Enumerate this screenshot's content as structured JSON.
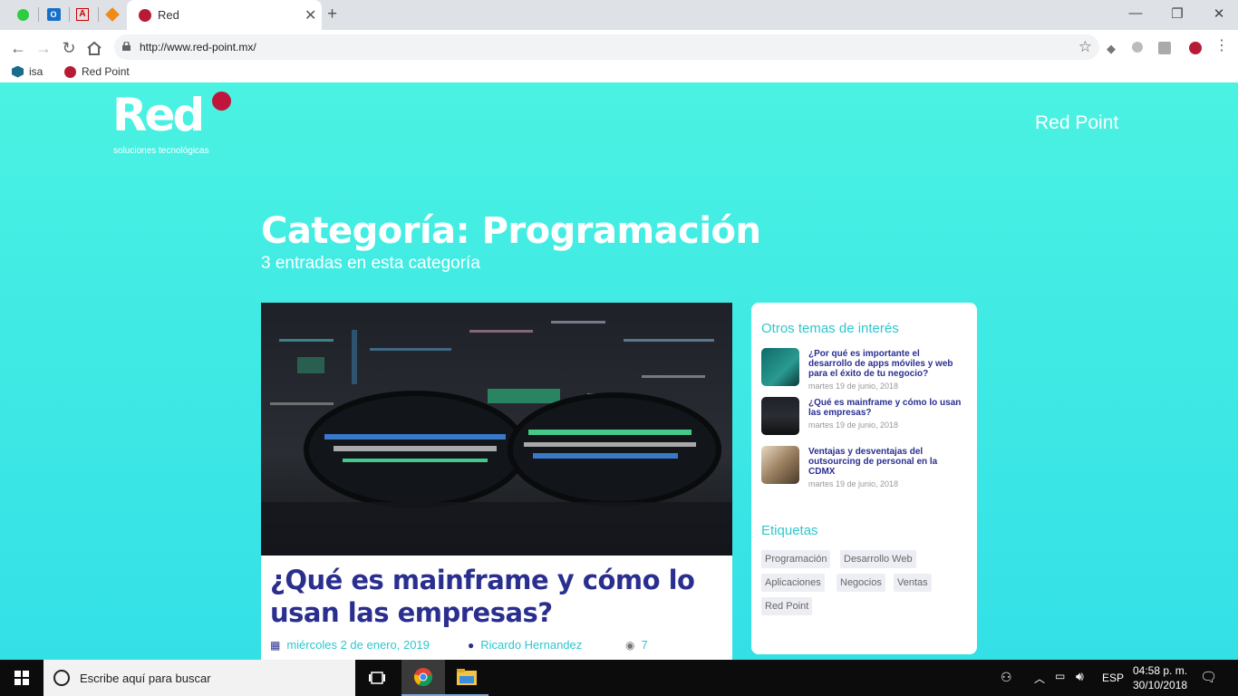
{
  "browser": {
    "tab_title": "Red",
    "url": "http://www.red-point.mx/",
    "bookmarks": [
      {
        "label": "isa"
      },
      {
        "label": "Red Point"
      }
    ]
  },
  "site": {
    "logo_text": "Red",
    "logo_tagline": "soluciones tecnológicas",
    "nav_title": "Red Point",
    "category_title": "Categoría: Programación",
    "category_subtitle": "3 entradas en esta categoría"
  },
  "post": {
    "title": "¿Qué es mainframe y cómo lo usan las empresas?",
    "date": "miércoles 2 de enero, 2019",
    "author": "Ricardo Hernandez",
    "views": "7"
  },
  "sidebar": {
    "heading": "Otros temas de interés",
    "items": [
      {
        "title": "¿Por qué es importante el desarrollo de apps móviles y web para el éxito de tu negocio?",
        "date": "martes 19 de junio, 2018"
      },
      {
        "title": "¿Qué es mainframe y cómo lo usan las empresas?",
        "date": "martes 19 de junio, 2018"
      },
      {
        "title": "Ventajas y desventajas del outsourcing de personal en la CDMX",
        "date": "martes 19 de junio, 2018"
      }
    ],
    "tags_heading": "Etiquetas",
    "tags": [
      "Programación",
      "Desarrollo Web",
      "Aplicaciones",
      "Negocios",
      "Ventas",
      "Red Point"
    ]
  },
  "taskbar": {
    "search_placeholder": "Escribe aquí para buscar",
    "language": "ESP",
    "time": "04:58 p. m.",
    "date": "30/10/2018"
  },
  "colors": {
    "page_bg": "#4af2e2",
    "brand_red": "#c0143c",
    "title_blue": "#2a2f8f",
    "accent_teal": "#2fc7cc"
  }
}
